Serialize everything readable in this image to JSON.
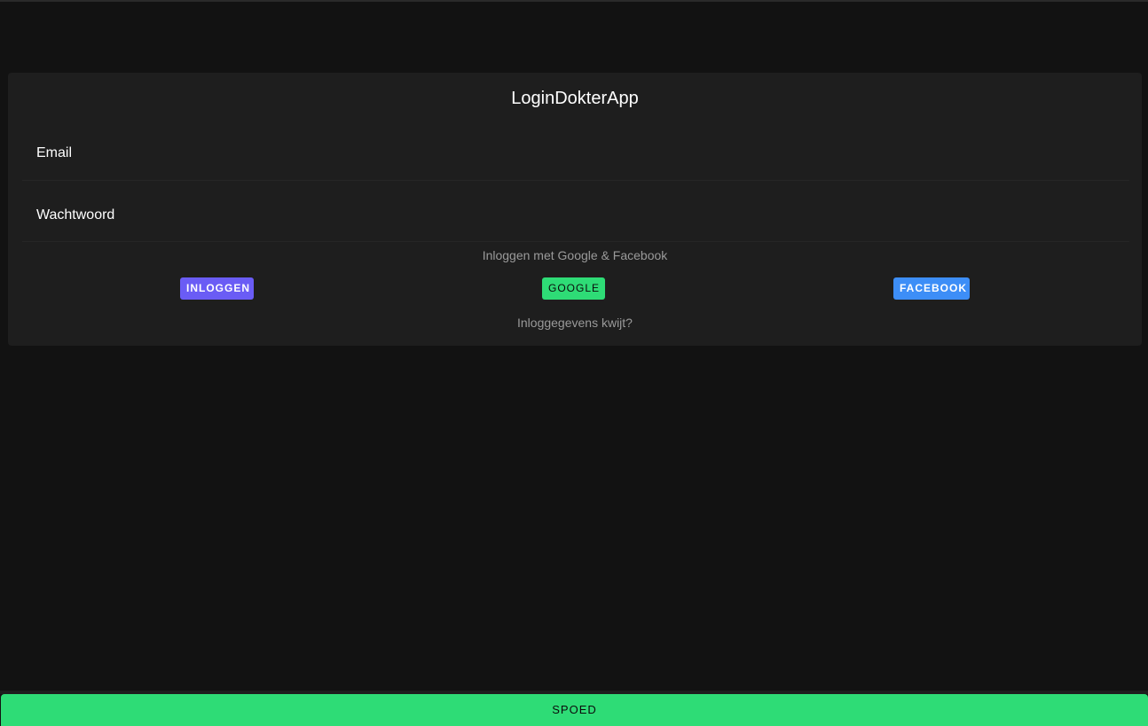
{
  "login": {
    "title": "LoginDokterApp",
    "email_label": "Email",
    "email_value": "",
    "password_label": "Wachtwoord",
    "password_value": "",
    "social_text": "Inloggen met Google & Facebook",
    "login_button": "INLOGGEN",
    "google_button": "GOOGLE",
    "facebook_button": "FACEBOOK",
    "forgot_link": "Inloggegevens kwijt?"
  },
  "footer": {
    "spoed_button": "SPOED"
  },
  "colors": {
    "background": "#121212",
    "card": "#1e1e1e",
    "login_button": "#6a5cf5",
    "google_button": "#2edc76",
    "facebook_button": "#3d8ef7",
    "spoed_button": "#2edc76"
  }
}
